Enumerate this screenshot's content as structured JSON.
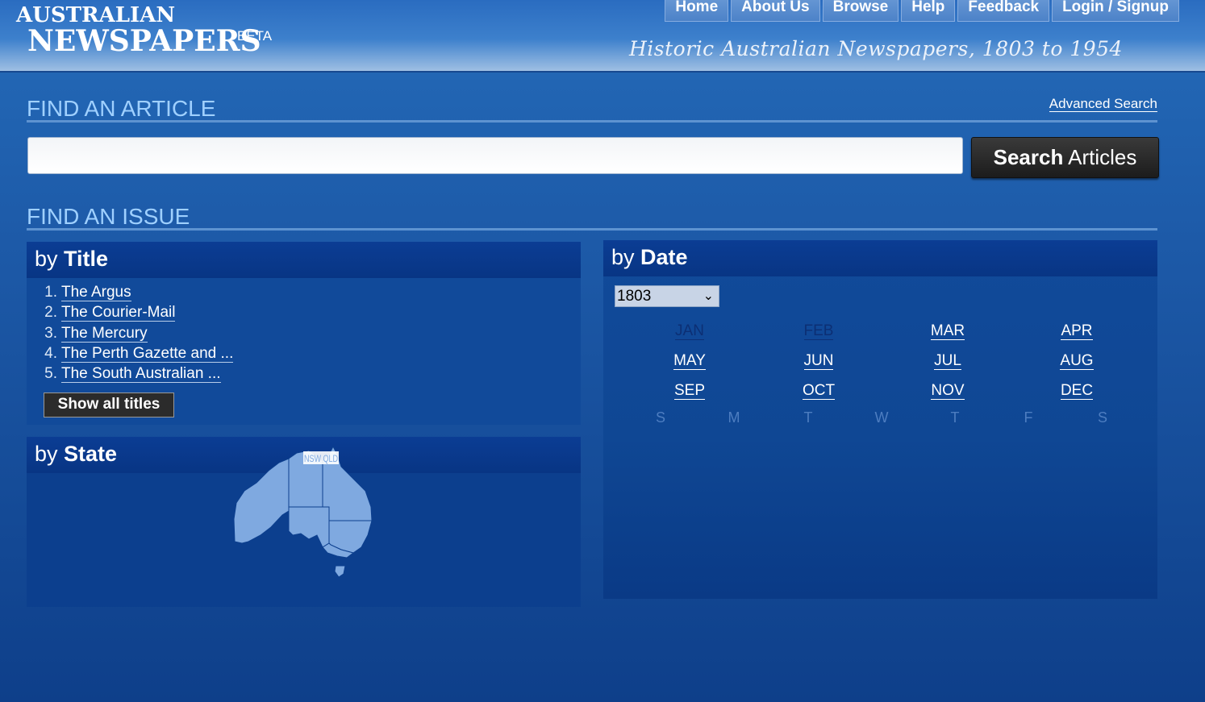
{
  "header": {
    "logo_line1": "AUSTRALIAN",
    "logo_line2": "NEWSPAPERS",
    "logo_beta": "BETA",
    "tagline": "Historic Australian Newspapers, 1803 to 1954",
    "nav": [
      "Home",
      "About Us",
      "Browse",
      "Help",
      "Feedback",
      "Login / Signup"
    ]
  },
  "find_article": {
    "heading": "FIND AN ARTICLE",
    "advanced_link": "Advanced Search",
    "search_value": "",
    "button_bold": "Search",
    "button_rest": " Articles"
  },
  "find_issue": {
    "heading": "FIND AN ISSUE",
    "by_title": {
      "prefix": "by ",
      "label": "Title",
      "titles": [
        {
          "num": "1.",
          "name": "The Argus"
        },
        {
          "num": "2.",
          "name": "The Courier-Mail"
        },
        {
          "num": "3.",
          "name": "The Mercury"
        },
        {
          "num": "4.",
          "name": "The Perth Gazette and ..."
        },
        {
          "num": "5.",
          "name": "The South Australian ..."
        }
      ],
      "show_all": "Show all titles"
    },
    "by_state": {
      "prefix": "by ",
      "label": "State",
      "map_labels": "NSW QLD"
    },
    "by_date": {
      "prefix": "by ",
      "label": "Date",
      "selected_year": "1803",
      "months": [
        {
          "label": "JAN",
          "enabled": false
        },
        {
          "label": "FEB",
          "enabled": false
        },
        {
          "label": "MAR",
          "enabled": true
        },
        {
          "label": "APR",
          "enabled": true
        },
        {
          "label": "MAY",
          "enabled": true
        },
        {
          "label": "JUN",
          "enabled": true
        },
        {
          "label": "JUL",
          "enabled": true
        },
        {
          "label": "AUG",
          "enabled": true
        },
        {
          "label": "SEP",
          "enabled": true
        },
        {
          "label": "OCT",
          "enabled": true
        },
        {
          "label": "NOV",
          "enabled": true
        },
        {
          "label": "DEC",
          "enabled": true
        }
      ],
      "weekdays": [
        "S",
        "M",
        "T",
        "W",
        "T",
        "F",
        "S"
      ]
    }
  },
  "colors": {
    "heading": "#9fd0ff",
    "panel_head": "#0b3d94",
    "map_fill": "#7fa9e0"
  }
}
